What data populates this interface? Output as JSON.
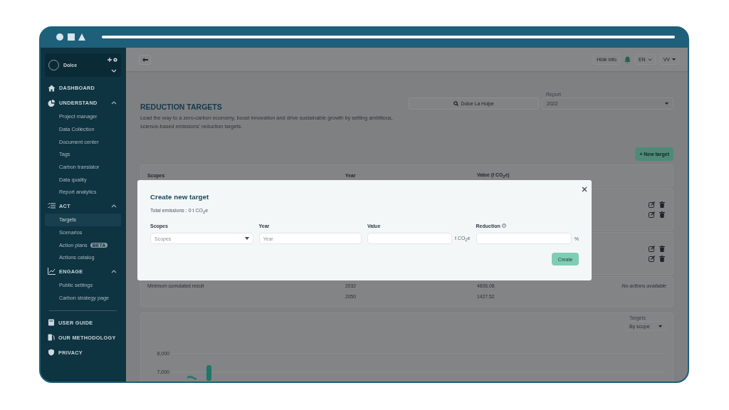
{
  "sidebar": {
    "organization": {
      "name": "Dolce"
    },
    "sections": [
      {
        "label": "DASHBOARD"
      },
      {
        "label": "UNDERSTAND",
        "expanded": true,
        "children": [
          {
            "label": "Project manager",
            "selected": false
          },
          {
            "label": "Data Collection",
            "selected": false
          },
          {
            "label": "Document center",
            "selected": false
          },
          {
            "label": "Tags",
            "selected": false
          },
          {
            "label": "Carbon translator",
            "selected": false
          },
          {
            "label": "Data quality",
            "selected": false
          },
          {
            "label": "Report analytics",
            "selected": false
          }
        ]
      },
      {
        "label": "ACT",
        "expanded": true,
        "children": [
          {
            "label": "Targets",
            "selected": true
          },
          {
            "label": "Scenarios",
            "selected": false
          },
          {
            "label": "Action plans",
            "selected": false,
            "badge": "BETA"
          },
          {
            "label": "Actions catalog",
            "selected": false
          }
        ]
      },
      {
        "label": "ENGAGE",
        "expanded": true,
        "children": [
          {
            "label": "Public settings",
            "selected": false
          },
          {
            "label": "Carbon strategy page",
            "selected": false
          }
        ]
      }
    ],
    "footer_links": [
      {
        "label": "USER GUIDE"
      },
      {
        "label": "OUR METHODOLOGY"
      },
      {
        "label": "PRIVACY"
      }
    ]
  },
  "topbar": {
    "hide_info": "Hide info",
    "language": "EN",
    "user": "VV"
  },
  "page": {
    "title": "REDUCTION TARGETS",
    "description": "Lead the way to a zero-carbon economy, boost innovation and drive sustainable growth by setting ambitious, science-based emissions' reduction targets.",
    "site_button": "Dolce La Hulpe",
    "report": {
      "label": "Report",
      "value": "2022"
    },
    "new_target_button": "+ New target"
  },
  "table": {
    "columns": [
      "Scopes",
      "Year",
      "Value (t CO$_{2}$e)"
    ],
    "results": [
      {
        "scopes": "Minimum cumulated result",
        "year": "2032",
        "value": "4606.08",
        "note": "No actions available"
      },
      {
        "year": "2050",
        "value": "1427.52"
      }
    ]
  },
  "chart_panel": {
    "select": {
      "label": "Targets",
      "value": "By scope"
    },
    "y_tick_labels": [
      "8,000",
      "7,000"
    ]
  },
  "modal": {
    "title": "Create new target",
    "total": "Total emissions : 0 t CO$_{2}$e",
    "fields": [
      {
        "kind": "select",
        "label": "Scopes",
        "placeholder": "Scopes"
      },
      {
        "kind": "input",
        "label": "Year",
        "placeholder": "Year"
      },
      {
        "kind": "input",
        "label": "Value",
        "unit": "t CO$_{2}$e"
      },
      {
        "kind": "input",
        "label": "Reduction",
        "info": true,
        "unit": "%"
      }
    ],
    "button": "Create"
  }
}
